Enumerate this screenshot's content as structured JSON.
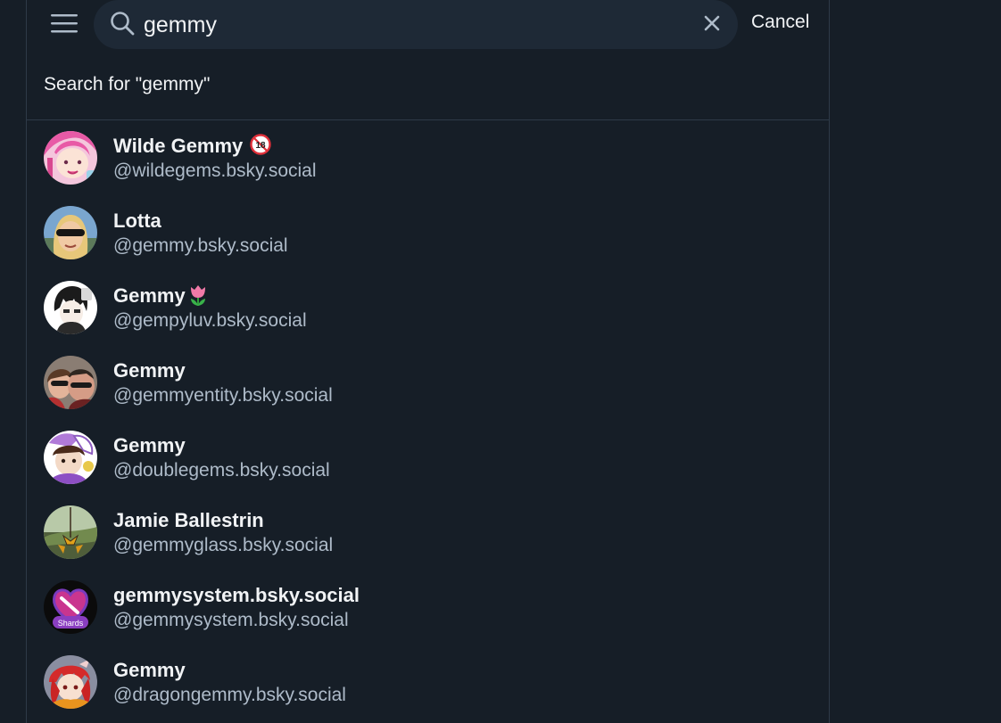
{
  "search": {
    "query": "gemmy",
    "cancel_label": "Cancel",
    "search_for_label": "Search for \"gemmy\""
  },
  "results": [
    {
      "display_name": "Wilde Gemmy",
      "handle": "@wildegems.bsky.social",
      "badge": "18-plus-icon"
    },
    {
      "display_name": "Lotta",
      "handle": "@gemmy.bsky.social"
    },
    {
      "display_name": "Gemmy",
      "handle": "@gempyluv.bsky.social",
      "badge": "tulip-icon"
    },
    {
      "display_name": "Gemmy",
      "handle": "@gemmyentity.bsky.social"
    },
    {
      "display_name": "Gemmy",
      "handle": "@doublegems.bsky.social"
    },
    {
      "display_name": "Jamie Ballestrin",
      "handle": "@gemmyglass.bsky.social"
    },
    {
      "display_name": "gemmysystem.bsky.social",
      "handle": "@gemmysystem.bsky.social",
      "avatar_text": "Shards"
    },
    {
      "display_name": "Gemmy",
      "handle": "@dragongemmy.bsky.social"
    }
  ],
  "colors": {
    "background": "#161e27",
    "search_box": "#1e2936",
    "text": "#f1f3f5",
    "muted_text": "#aebbc9",
    "border": "#2e3a48"
  }
}
